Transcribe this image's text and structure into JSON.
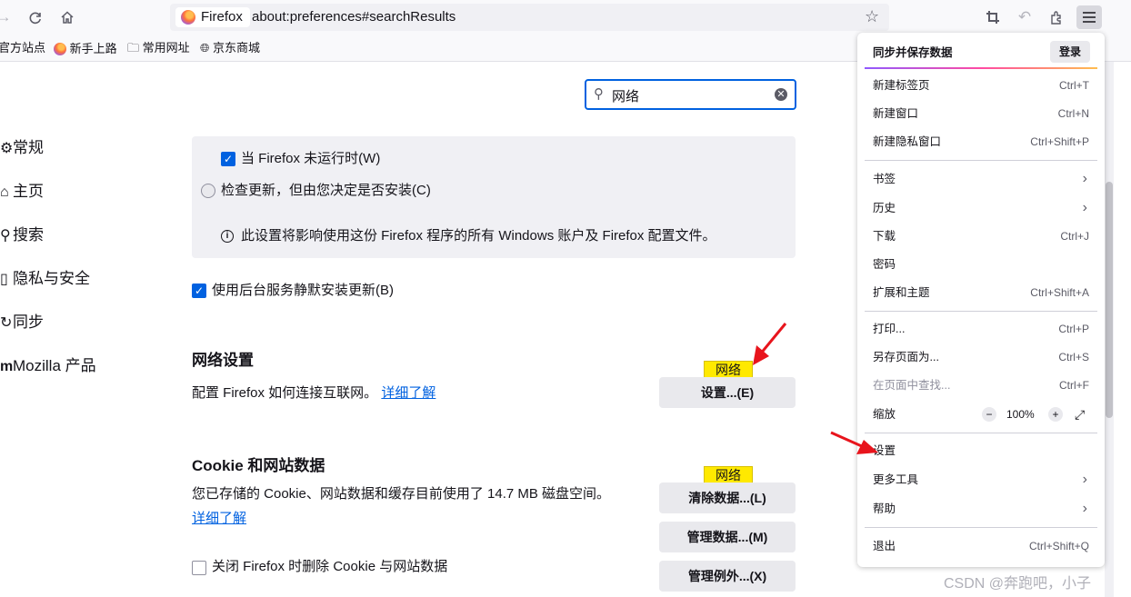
{
  "urlbar": {
    "identity": "Firefox",
    "url": "about:preferences#searchResults"
  },
  "bookmarks": [
    {
      "label": "官方站点"
    },
    {
      "label": "新手上路"
    },
    {
      "label": "常用网址"
    },
    {
      "label": "京东商城"
    }
  ],
  "sidebar": {
    "items": [
      {
        "label": "常规",
        "icon": "gear-icon"
      },
      {
        "label": "主页",
        "icon": "home-icon"
      },
      {
        "label": "搜索",
        "icon": "search-icon"
      },
      {
        "label": "隐私与安全",
        "icon": "lock-icon"
      },
      {
        "label": "同步",
        "icon": "sync-icon"
      },
      {
        "label": "Mozilla 产品",
        "icon": "mozilla-icon"
      }
    ]
  },
  "search": {
    "value": "网络"
  },
  "updates": {
    "when_not_running": "当 Firefox 未运行时(W)",
    "check_only": "检查更新，但由您决定是否安装(C)",
    "info": "此设置将影响使用这份 Firefox 程序的所有 Windows 账户及 Firefox 配置文件。",
    "background_service": "使用后台服务静默安装更新(B)"
  },
  "network": {
    "title": "网络设置",
    "description": "配置 Firefox 如何连接互联网。",
    "learn_more": "详细了解",
    "highlight": "网络",
    "button": "设置...(E)"
  },
  "cookies": {
    "title": "Cookie 和网站数据",
    "description": "您已存储的 Cookie、网站数据和缓存目前使用了 14.7 MB 磁盘空间。",
    "learn_more": "详细了解",
    "highlight": "网络",
    "clear_button": "清除数据...(L)",
    "manage_button": "管理数据...(M)",
    "exceptions_button": "管理例外...(X)",
    "delete_on_close": "关闭 Firefox 时删除 Cookie 与网站数据"
  },
  "menu": {
    "sync_title": "同步并保存数据",
    "login": "登录",
    "new_tab": {
      "label": "新建标签页",
      "key": "Ctrl+T"
    },
    "new_window": {
      "label": "新建窗口",
      "key": "Ctrl+N"
    },
    "new_private": {
      "label": "新建隐私窗口",
      "key": "Ctrl+Shift+P"
    },
    "bookmarks": {
      "label": "书签"
    },
    "history": {
      "label": "历史"
    },
    "downloads": {
      "label": "下载",
      "key": "Ctrl+J"
    },
    "passwords": {
      "label": "密码"
    },
    "addons": {
      "label": "扩展和主题",
      "key": "Ctrl+Shift+A"
    },
    "print": {
      "label": "打印...",
      "key": "Ctrl+P"
    },
    "save_as": {
      "label": "另存页面为...",
      "key": "Ctrl+S"
    },
    "find": {
      "label": "在页面中查找...",
      "key": "Ctrl+F"
    },
    "zoom": {
      "label": "缩放",
      "minus": "−",
      "value": "100%",
      "plus": "+"
    },
    "settings": {
      "label": "设置"
    },
    "more_tools": {
      "label": "更多工具"
    },
    "help": {
      "label": "帮助"
    },
    "exit": {
      "label": "退出",
      "key": "Ctrl+Shift+Q"
    }
  },
  "watermark": "CSDN @奔跑吧，小子",
  "colors": {
    "accent": "#0061e0",
    "highlight": "#ffe900",
    "arrow": "#e8141c"
  }
}
